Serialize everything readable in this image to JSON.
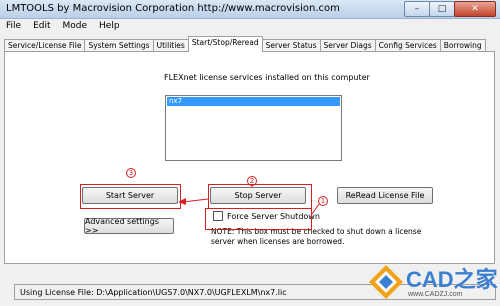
{
  "window": {
    "title": "LMTOOLS by Macrovision Corporation http://www.macrovision.com",
    "minimize_glyph": "–",
    "maximize_glyph": "□",
    "close_glyph": "✕"
  },
  "menu": [
    "File",
    "Edit",
    "Mode",
    "Help"
  ],
  "tabs": [
    {
      "label": "Service/License File",
      "active": false
    },
    {
      "label": "System Settings",
      "active": false
    },
    {
      "label": "Utilities",
      "active": false
    },
    {
      "label": "Start/Stop/Reread",
      "active": true
    },
    {
      "label": "Server Status",
      "active": false
    },
    {
      "label": "Server Diags",
      "active": false
    },
    {
      "label": "Config Services",
      "active": false
    },
    {
      "label": "Borrowing",
      "active": false
    }
  ],
  "panel": {
    "services_label": "FLEXnet license services installed on this computer",
    "selected_service": "nx7",
    "start_button": "Start Server",
    "stop_button": "Stop Server",
    "reread_button": "ReRead License File",
    "advanced_button": "Advanced settings >>",
    "force_shutdown_label": "Force Server Shutdown",
    "force_shutdown_checked": false,
    "note": "NOTE:  This box must be checked to shut down a license server when licenses are borrowed."
  },
  "status": {
    "text": "Using License File:  D:\\Application\\UGS7.0\\NX7.0\\UGFLEXLM\\nx7.lic"
  },
  "annotations": {
    "step1": "1",
    "step2": "2",
    "step3": "3",
    "color": "#d42020"
  },
  "watermark": {
    "brand": "CAD之家",
    "url": "www.CADZJ.com"
  }
}
